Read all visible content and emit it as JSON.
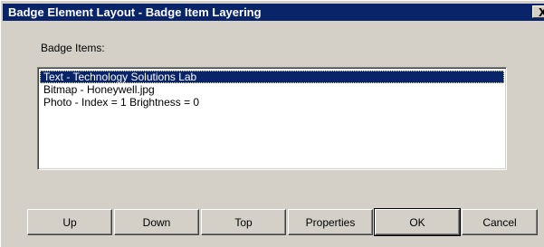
{
  "window": {
    "title": "Badge Element Layout - Badge Item Layering",
    "close_glyph": "X"
  },
  "badge_items": {
    "label": "Badge Items:",
    "items": [
      "Text - Technology Solutions Lab",
      "Bitmap - Honeywell.jpg",
      "Photo - Index = 1 Brightness = 0"
    ],
    "selected": "Text - Technology Solutions Lab"
  },
  "buttons": {
    "up": "Up",
    "down": "Down",
    "top": "Top",
    "properties": "Properties",
    "ok": "OK",
    "cancel": "Cancel"
  },
  "colors": {
    "title_bar": "#0a246a",
    "dialog_face": "#d4d0c8",
    "selection": "#0a246a"
  },
  "icons": {
    "close": "close-icon"
  }
}
